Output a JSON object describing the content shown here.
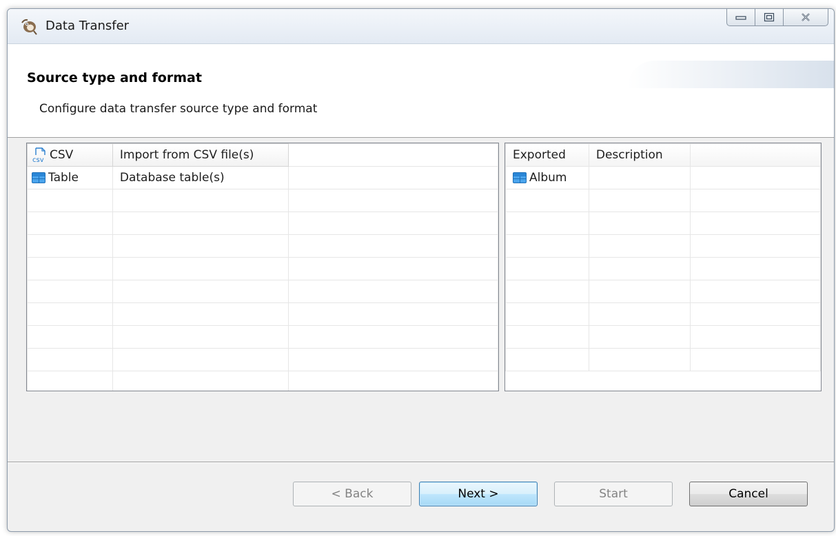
{
  "window": {
    "title": "Data Transfer"
  },
  "header": {
    "title": "Source type and format",
    "description": "Configure data transfer source type and format"
  },
  "source_types": {
    "rows": [
      {
        "icon": "csv-file-icon",
        "name": "CSV",
        "description": "Import from CSV file(s)"
      },
      {
        "icon": "table-icon",
        "name": "Table",
        "description": "Database table(s)"
      }
    ]
  },
  "exported": {
    "columns": [
      "Exported",
      "Description"
    ],
    "rows": [
      {
        "icon": "table-icon",
        "name": "Album",
        "description": ""
      }
    ]
  },
  "buttons": {
    "back": "< Back",
    "next": "Next >",
    "start": "Start",
    "cancel": "Cancel"
  }
}
